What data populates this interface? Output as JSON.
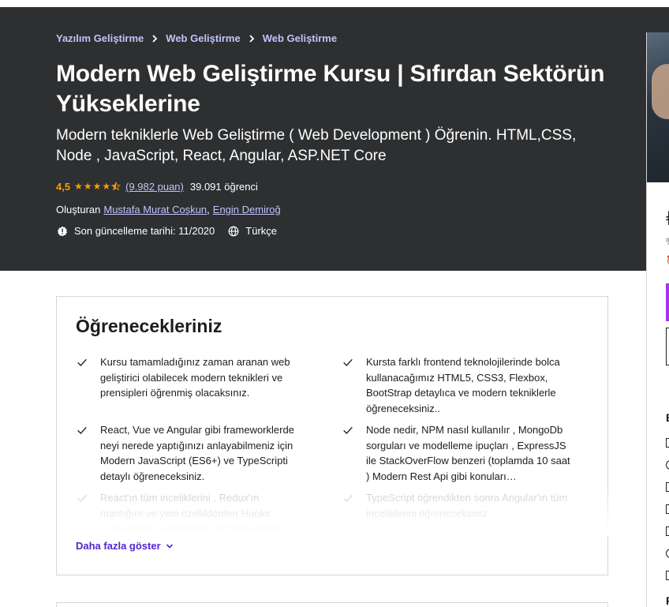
{
  "breadcrumb": [
    "Yazılım Geliştirme",
    "Web Geliştirme",
    "Web Geliştirme"
  ],
  "course": {
    "title": "Modern Web Geliştirme Kursu | Sıfırdan Sektörün Yükseklerine",
    "subtitle": "Modern tekniklerle Web Geliştirme ( Web Development ) Öğrenin. HTML,CSS, Node , JavaScript, React, Angular, ASP.NET Core",
    "rating": "4,5",
    "rating_count": "(9.982 puan)",
    "students": "39.091 öğrenci",
    "created_by_label": "Oluşturan",
    "instructors": [
      "Mustafa Murat Coşkun",
      "Engin Demiroğ"
    ],
    "instructor_separator": ",",
    "last_updated": "Son güncelleme tarihi: 11/2020",
    "language": "Türkçe"
  },
  "icons": {
    "star": "star-icon",
    "half_star": "half-star-icon",
    "update": "alert-badge-icon",
    "language": "globe-icon",
    "check": "check-icon",
    "chevron": "chevron-down-icon"
  },
  "learn": {
    "title": "Öğrenecekleriniz",
    "items": [
      "Kursu tamamladığınız zaman aranan web geliştirici olabilecek modern teknikleri ve prensipleri öğrenmiş olacaksınız.",
      "Kursta farklı frontend teknolojilerinde bolca kullanacağımız HTML5, CSS3, Flexbox, BootStrap detaylıca ve modern tekniklerle öğreneceksiniz..",
      "React, Vue ve Angular gibi frameworklerde neyi nerede yaptığınızı anlayabilmeniz için Modern JavaScript (ES6+) ve TypeScripti detaylı öğreneceksiniz.",
      "Node nedir, NPM nasıl kullanılır , MongoDb sorguları ve modelleme ipuçları , ExpressJS ile StackOverFlow benzeri (toplamda 10 saat ) Modern Rest Api gibi konuları…",
      "React'ın tüm inceliklerini , Redux'ın mantığını ve yeni özelliklerden Hooks kullanmanın avantajlarını öğreneceksiniz.",
      "TypeScript öğrendikten sonra Angular'ın tüm inceliklerini öğreneceksiniz."
    ],
    "show_more": "Daha fazla göster"
  },
  "colors": {
    "hero_bg": "#2d2f31",
    "link": "#c0c4fc",
    "star": "#f69c08",
    "purple": "#5624d0",
    "cta": "#a435f0"
  }
}
